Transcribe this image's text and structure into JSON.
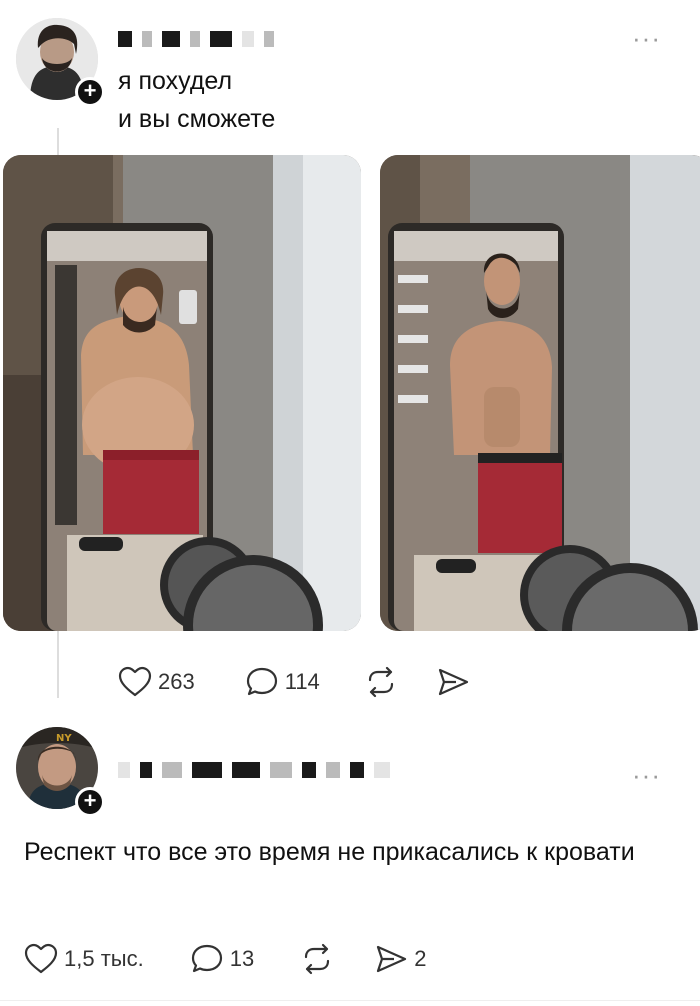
{
  "post": {
    "text_line1": "я похудел",
    "text_line2": "и вы сможете",
    "likes": "263",
    "comments": "114"
  },
  "reply": {
    "text": "Респект что все это время не прикасались к кровати",
    "likes": "1,5 тыс.",
    "comments": "13",
    "shares": "2"
  },
  "icons": {
    "like": "heart-icon",
    "comment": "comment-bubble-icon",
    "repost": "repost-icon",
    "share": "send-icon",
    "more": "more-dots-icon",
    "follow": "plus-icon"
  },
  "colors": {
    "text": "#111111",
    "icon": "#333333",
    "muted": "#9a9a9a",
    "badge": "#111111"
  },
  "more_glyph": "···",
  "follow_glyph": "+"
}
